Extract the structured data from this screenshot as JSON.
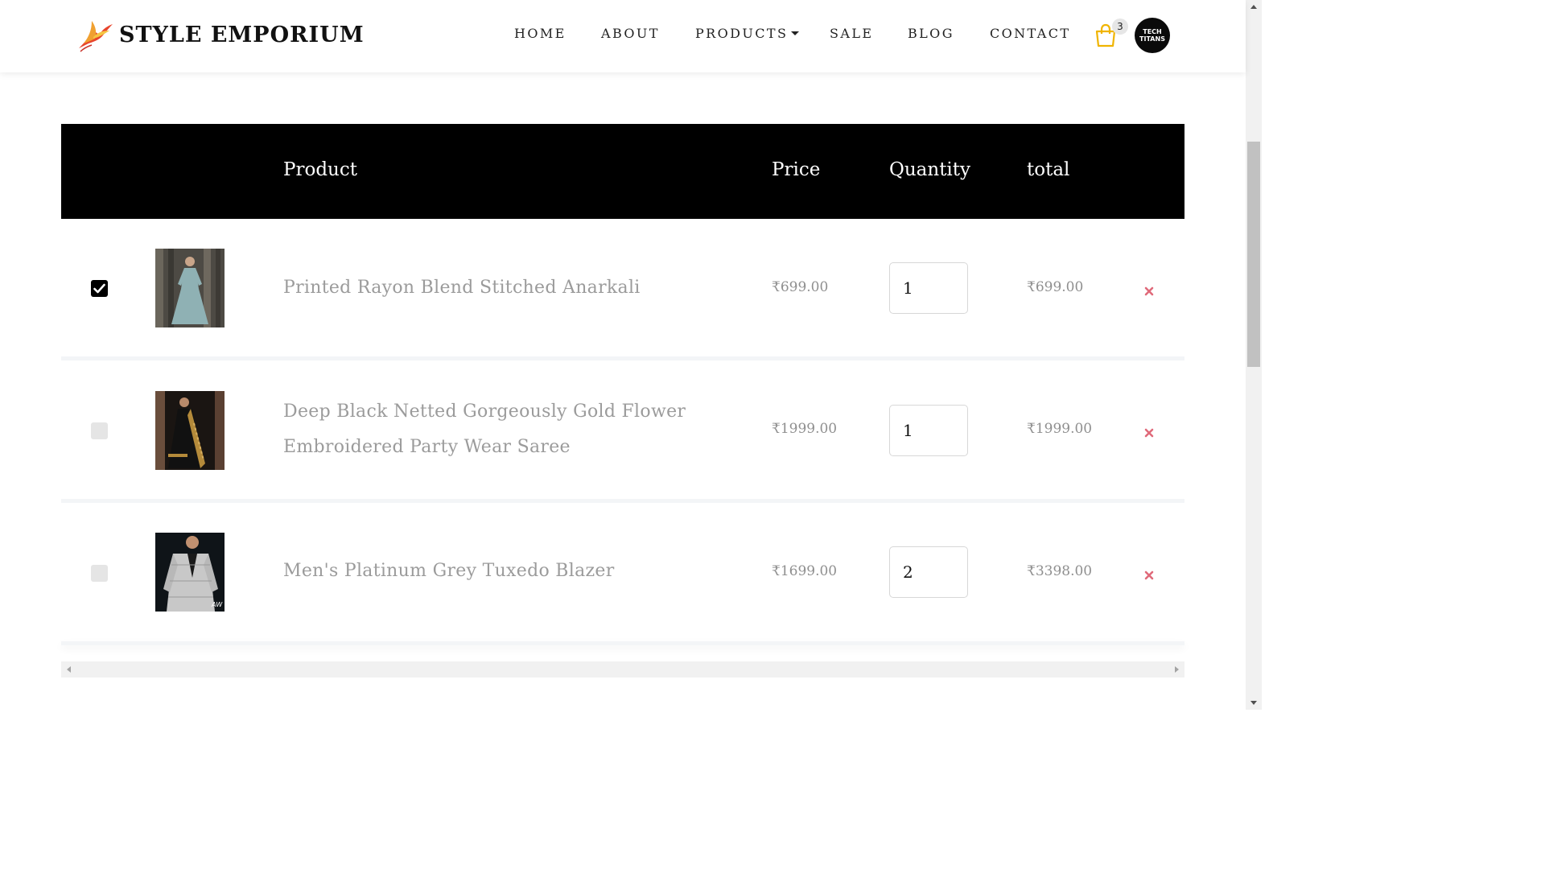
{
  "brand": {
    "name": "STYLE EMPORIUM",
    "logo_icon": "phoenix-bird-logo"
  },
  "nav": {
    "items": [
      {
        "label": "HOME"
      },
      {
        "label": "ABOUT"
      },
      {
        "label": "PRODUCTS",
        "has_dropdown": true
      },
      {
        "label": "SALE"
      },
      {
        "label": "BLOG"
      },
      {
        "label": "CONTACT"
      }
    ],
    "cart_icon": "shopping-bag-icon",
    "cart_count": "3",
    "avatar_text_line1": "TECH",
    "avatar_text_line2": "TITANS"
  },
  "cart_table": {
    "headers": {
      "product": "Product",
      "price": "Price",
      "quantity": "Quantity",
      "total": "total"
    },
    "rows": [
      {
        "selected": true,
        "name": "Printed Rayon Blend Stitched Anarkali",
        "price": "₹699.00",
        "quantity": "1",
        "total": "₹699.00",
        "image_icon": "anarkali-product-photo"
      },
      {
        "selected": false,
        "name": "Deep Black Netted Gorgeously Gold Flower Embroidered Party Wear Saree",
        "price": "₹1999.00",
        "quantity": "1",
        "total": "₹1999.00",
        "image_icon": "saree-product-photo"
      },
      {
        "selected": false,
        "name": "Men's Platinum Grey Tuxedo Blazer",
        "price": "₹1699.00",
        "quantity": "2",
        "total": "₹3398.00",
        "image_icon": "blazer-product-photo"
      }
    ]
  },
  "colors": {
    "header_bg": "#000000",
    "accent_cart": "#f0b400",
    "remove_icon": "#e06a7a",
    "muted_text": "#9b9b9b"
  }
}
